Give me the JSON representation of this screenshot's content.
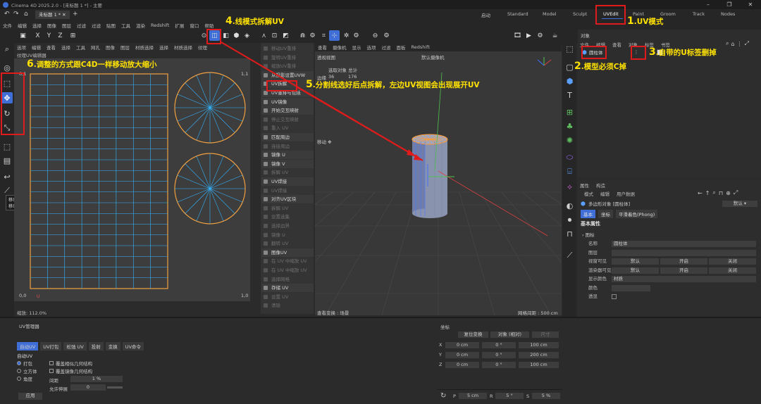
{
  "window": {
    "title": "Cinema 4D 2025.2.0 - [未标题 1 *] - 主要",
    "tab": "未标题 1 *"
  },
  "layouts": [
    "启动",
    "Standard",
    "Model",
    "Sculpt",
    "UVEdit",
    "Paint",
    "Groom",
    "Track",
    "Nodes"
  ],
  "active_layout": "UVEdit",
  "menu": [
    "文件",
    "编辑",
    "创建",
    "模式",
    "选择",
    "工具",
    "样条",
    "网格",
    "体积",
    "运动图形",
    "角色",
    "动画",
    "模拟",
    "跟踪器",
    "渲染",
    "扩展",
    "窗口",
    "帮助"
  ],
  "menu_small": [
    "文件",
    "编辑",
    "选择",
    "图像",
    "图层",
    "过滤",
    "过滤",
    "贴图",
    "工具",
    "渲染",
    "Redshift",
    "扩展",
    "窗口",
    "帮助"
  ],
  "toolbar_xyz": [
    "X",
    "Y",
    "Z"
  ],
  "uv_editor": {
    "menu": [
      "选项",
      "编辑",
      "查看",
      "选择",
      "工具",
      "网孔",
      "图像",
      "图层",
      "材质选择",
      "选择",
      "材质选择",
      "纹理"
    ],
    "title": "纹理UV编辑器",
    "corner_tl": "0,1",
    "corner_tr": "1,1",
    "corner_bl": "0,0",
    "corner_br": "1,0",
    "axis_u": "U",
    "zoom": "缩放: 112.0%"
  },
  "uv_commands": [
    {
      "label": "移动UV重排",
      "dis": true
    },
    {
      "label": "旋转UV重排",
      "dis": true
    },
    {
      "label": "缩放UV重排",
      "dis": true
    },
    {
      "label": "从投影设置UVW",
      "dis": false
    },
    {
      "label": "UV拆解",
      "dis": false
    },
    {
      "label": "UV重排与包括",
      "dis": false
    },
    {
      "label": "UV镜像",
      "dis": false
    },
    {
      "label": "开始交互映射",
      "dis": false
    },
    {
      "label": "停止交互映射",
      "dis": true
    },
    {
      "label": "重入 UV",
      "dis": true
    },
    {
      "label": "匹配周边",
      "dis": false
    },
    {
      "label": "连接周边",
      "dis": true
    },
    {
      "label": "镜像 U",
      "dis": false
    },
    {
      "label": "镜像 V",
      "dis": false
    },
    {
      "label": "拆解 UV",
      "dis": true
    },
    {
      "label": "UV焊接",
      "dis": false
    },
    {
      "label": "UV焊接",
      "dis": true
    },
    {
      "label": "对齐UV区块",
      "dis": false
    },
    {
      "label": "拆解 UV",
      "dis": true
    },
    {
      "label": "设置选集",
      "dis": true
    },
    {
      "label": "选择边界",
      "dis": true
    },
    {
      "label": "镜像 U",
      "dis": true
    },
    {
      "label": "翻转 UV",
      "dis": true
    },
    {
      "label": "图像UV",
      "dis": false
    },
    {
      "label": "在 UV 中缩放 UV",
      "dis": true
    },
    {
      "label": "在 UV 中缩放 UV",
      "dis": true
    },
    {
      "label": "选择网格",
      "dis": true
    },
    {
      "label": "存储 UV",
      "dis": false
    },
    {
      "label": "设置 UV",
      "dis": true
    },
    {
      "label": "清除",
      "dis": true
    }
  ],
  "viewport": {
    "menu": [
      "查看",
      "摄像机",
      "显示",
      "选项",
      "过滤",
      "面板",
      "Redshift"
    ],
    "name": "透视视图",
    "camera": "默认摄像机",
    "stats_header": "选取对象  总计",
    "stats_label": "边缘",
    "stats_sel": "36",
    "stats_total": "176",
    "move_label": "移动",
    "bottom_left": "查看变换 : 场景",
    "bottom_right": "网格间距 : 500 cm"
  },
  "objects": {
    "tab": "对象",
    "menu": [
      "文件",
      "编辑",
      "查看",
      "对象",
      "标签",
      "书签"
    ],
    "item": "圆柱体"
  },
  "attributes": {
    "tabs": [
      "属性",
      "构造"
    ],
    "menu": [
      "模式",
      "编辑",
      "用户数据"
    ],
    "object_label": "多边形对象 [圆柱体]",
    "mode_value": "默认",
    "subtabs": [
      "基本",
      "坐标",
      "平滑着色(Phong)"
    ],
    "section": "基本属性",
    "icon_label": "图标",
    "rows": [
      {
        "label": "名称",
        "value": "圆柱体"
      },
      {
        "label": "图层",
        "value": ""
      },
      {
        "label": "视窗可见",
        "vals": [
          "默认",
          "开启",
          "关闭"
        ]
      },
      {
        "label": "渲染器可见",
        "vals": [
          "默认",
          "开启",
          "关闭"
        ]
      },
      {
        "label": "显示颜色",
        "value": "材质"
      },
      {
        "label": "颜色",
        "value": ""
      },
      {
        "label": "透显",
        "value": ""
      }
    ]
  },
  "uv_manager": {
    "title": "UV管理器",
    "tabs": [
      "自动UV",
      "UV打包",
      "松弛 UV",
      "投射",
      "变换",
      "UV命令"
    ],
    "section": "自动UV",
    "options": [
      "打包",
      "立方体",
      "角度"
    ],
    "checks": [
      "覆盖相似几何结构",
      "覆盖镜像几何结构"
    ],
    "spacing_label": "间距",
    "spacing_value": "1 %",
    "rotate_label": "允许伸展",
    "rotate_value": "0",
    "apply_label": "应用"
  },
  "coordinates": {
    "title": "坐标",
    "buttons": [
      "复位变换",
      "对象 (相对)",
      "尺寸"
    ],
    "rows": [
      {
        "axis": "X",
        "pos": "0 cm",
        "rot": "0 °",
        "size": "100 cm"
      },
      {
        "axis": "Y",
        "pos": "0 cm",
        "rot": "0 °",
        "size": "200 cm"
      },
      {
        "axis": "Z",
        "pos": "0 cm",
        "rot": "0 °",
        "size": "100 cm"
      }
    ],
    "bottom": [
      {
        "k": "P",
        "v": "5 cm"
      },
      {
        "k": "R",
        "v": "5 °"
      },
      {
        "k": "S",
        "v": "5 %"
      }
    ]
  },
  "tooltip": {
    "line1": "移动 U",
    "line2": "移动 U 坐标"
  },
  "annotations": {
    "a1_num": "1",
    "a1": ".UV模式",
    "a2_num": "2",
    "a2": ".模型必须C掉",
    "a3_num": "3",
    "a3": ".自带的U标签删掉",
    "a4_num": "4",
    "a4": ".线模式拆解UV",
    "a5_num": "5",
    "a5": ".分割线选好后点拆解，左边UV视图会出现展开UV",
    "a6_num": "6",
    "a6": ".调整的方式跟C4D一样移动放大缩小"
  },
  "colors": {
    "annotation": "#ffe200",
    "highlight": "#e01b1b",
    "uv_lines": "#33b4ff",
    "uv_border": "#f0a040",
    "accent": "#3f6fd6"
  }
}
